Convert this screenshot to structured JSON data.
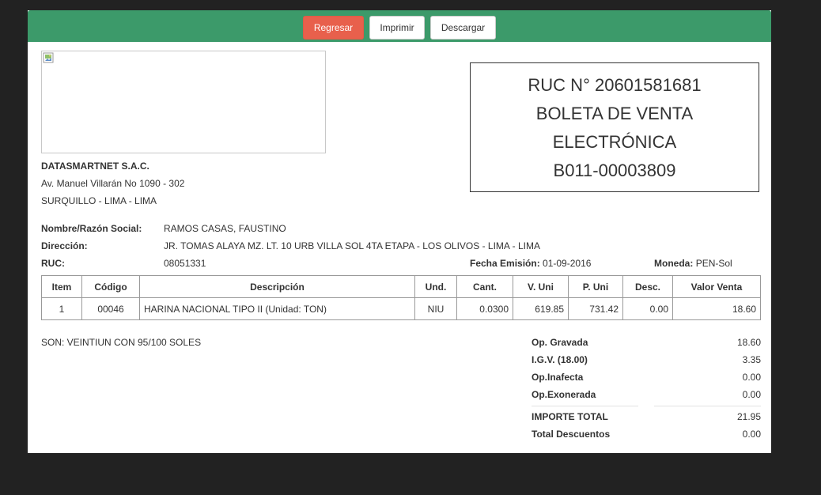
{
  "toolbar": {
    "back_label": "Regresar",
    "print_label": "Imprimir",
    "download_label": "Descargar",
    "back_color": "#e8604c",
    "bar_color": "#3c9a6a"
  },
  "company": {
    "name": "DATASMARTNET S.A.C.",
    "address": "Av. Manuel Villarán No 1090 - 302",
    "district": "SURQUILLO - LIMA - LIMA"
  },
  "document": {
    "ruc": "RUC N° 20601581681",
    "type_line1": "BOLETA DE VENTA",
    "type_line2": "ELECTRÓNICA",
    "number": "B011-00003809"
  },
  "client": {
    "name_label": "Nombre/Razón Social:",
    "name": "RAMOS CASAS, FAUSTINO",
    "address_label": "Dirección:",
    "address": "JR. TOMAS ALAYA MZ. LT. 10 URB VILLA SOL 4TA ETAPA - LOS OLIVOS - LIMA - LIMA",
    "ruc_label": "RUC:",
    "ruc": "08051331",
    "date_label": "Fecha Emisión:",
    "date": "01-09-2016",
    "currency_label": "Moneda:",
    "currency": "PEN-Sol"
  },
  "table": {
    "headers": [
      "Item",
      "Código",
      "Descripción",
      "Und.",
      "Cant.",
      "V. Uni",
      "P. Uni",
      "Desc.",
      "Valor Venta"
    ],
    "rows": [
      [
        "1",
        "00046",
        "HARINA NACIONAL TIPO II (Unidad: TON)",
        "NIU",
        "0.0300",
        "619.85",
        "731.42",
        "0.00",
        "18.60"
      ]
    ]
  },
  "amount_in_words": "SON: VEINTIUN CON 95/100 SOLES",
  "totals": [
    {
      "label": "Op. Gravada",
      "value": "18.60"
    },
    {
      "label": "I.G.V. (18.00)",
      "value": "3.35"
    },
    {
      "label": "Op.Inafecta",
      "value": "0.00"
    },
    {
      "label": "Op.Exonerada",
      "value": "0.00"
    },
    {
      "label": "IMPORTE TOTAL",
      "value": "21.95"
    },
    {
      "label": "Total Descuentos",
      "value": "0.00"
    }
  ]
}
